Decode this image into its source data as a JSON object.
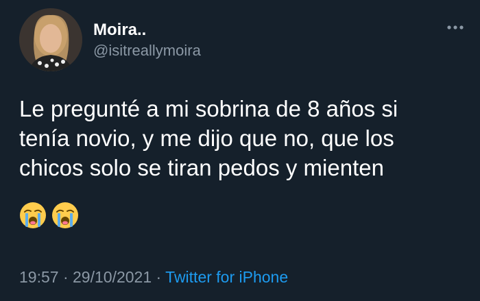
{
  "author": {
    "display_name": "Moira..",
    "handle": "@isitreallymoira"
  },
  "more_icon": "ellipsis-icon",
  "tweet": {
    "text": "Le pregunté a mi sobrina de 8 años si\ntenía novio, y me dijo que no, que los\nchicos solo se tiran pedos y mienten",
    "emojis": [
      "loudly-crying-face",
      "loudly-crying-face"
    ]
  },
  "footer": {
    "time": "19:57",
    "separator1": " · ",
    "date": "29/10/2021",
    "separator2": " · ",
    "source": "Twitter for iPhone"
  },
  "colors": {
    "background": "#15202b",
    "text": "#ffffff",
    "secondary_text": "#8b98a5",
    "link": "#1d9bf0"
  }
}
